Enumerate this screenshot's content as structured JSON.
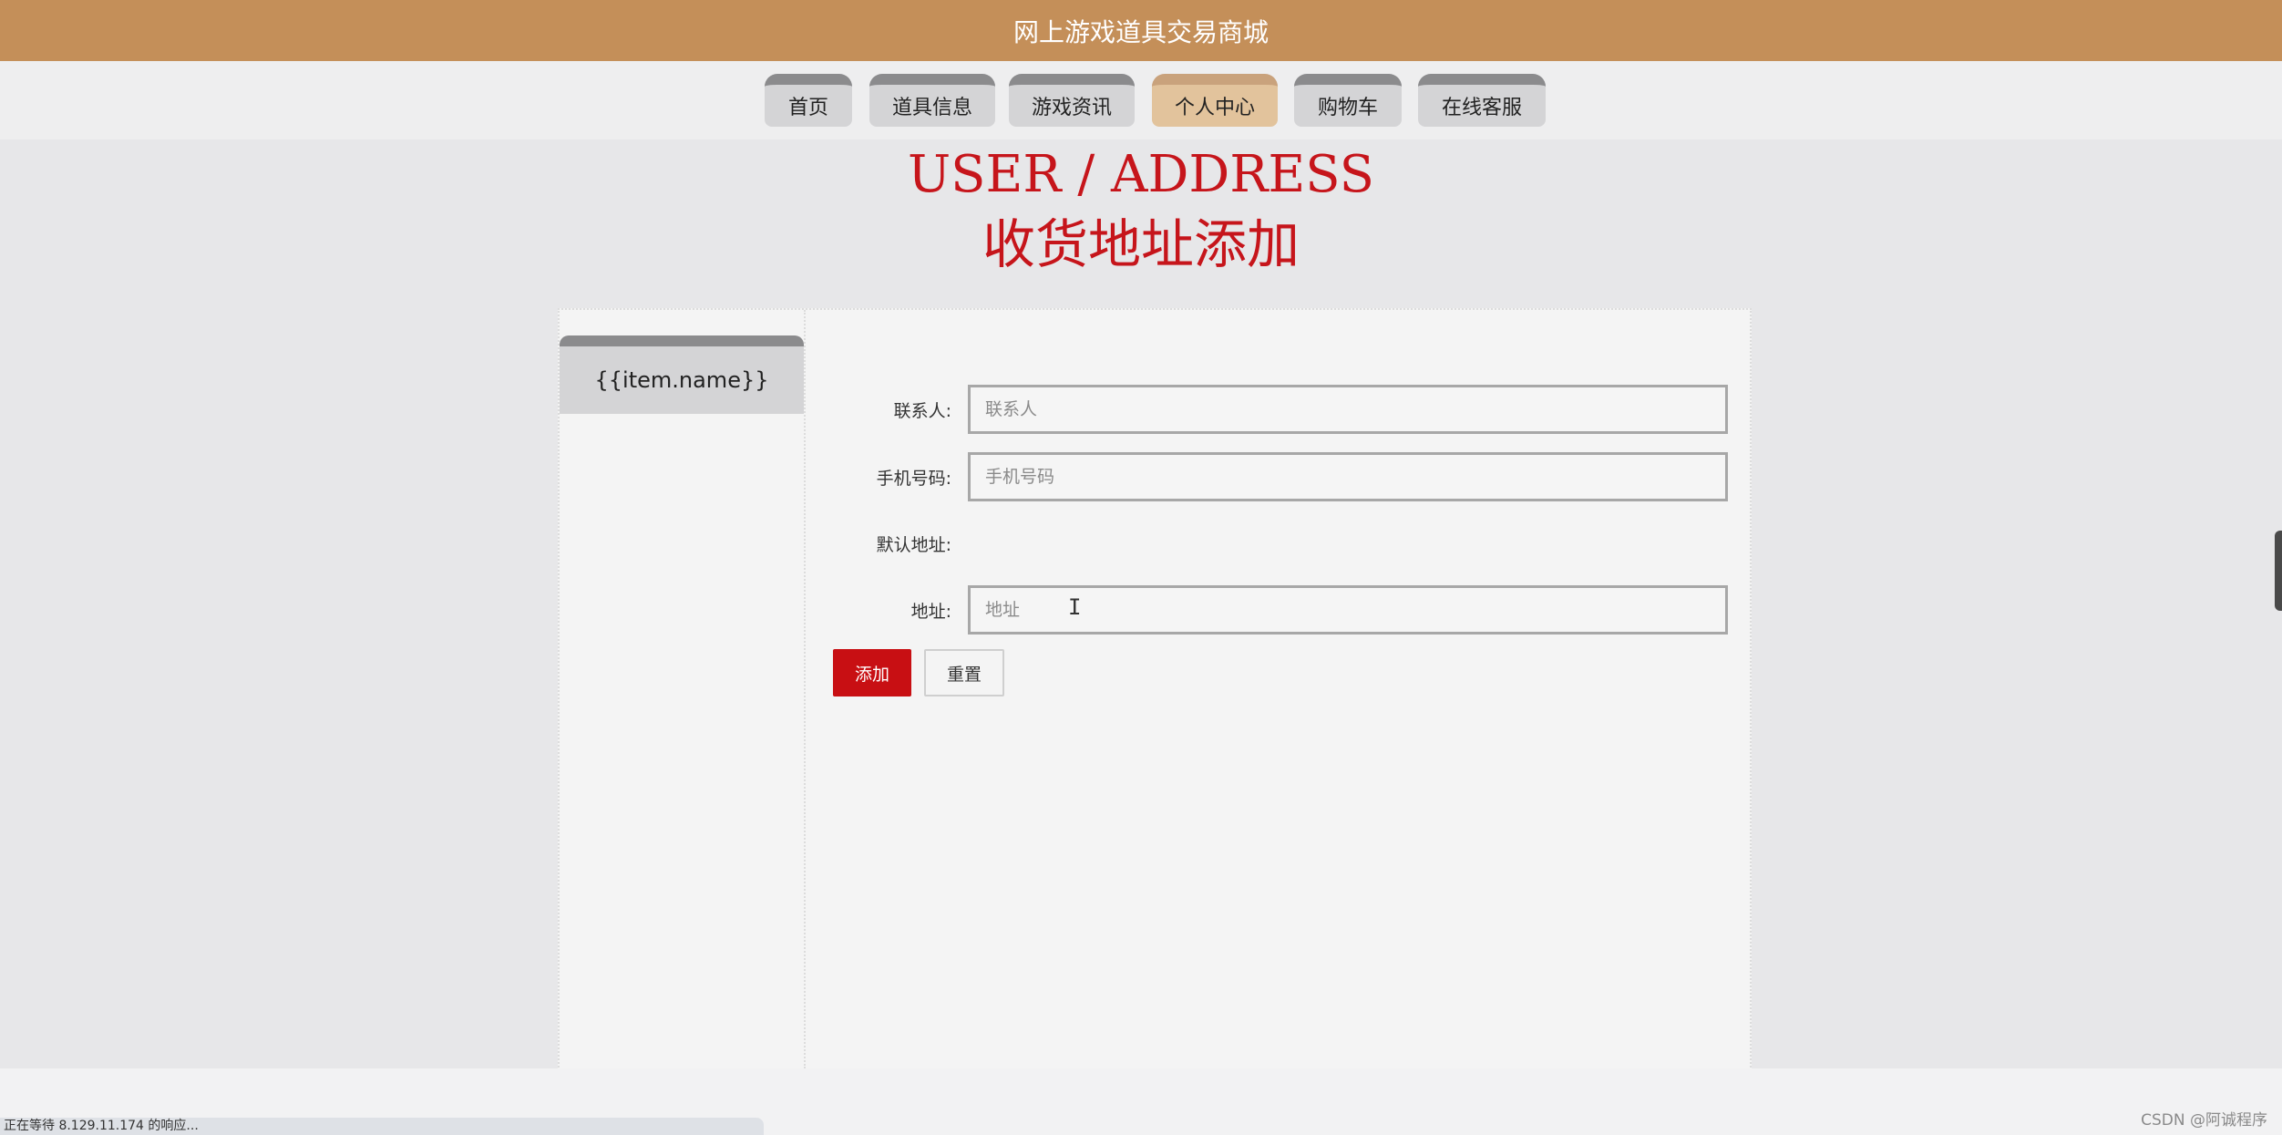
{
  "header": {
    "site_title": "网上游戏道具交易商城"
  },
  "nav": {
    "items": [
      {
        "label": "首页"
      },
      {
        "label": "道具信息"
      },
      {
        "label": "游戏资讯"
      },
      {
        "label": "个人中心"
      },
      {
        "label": "购物车"
      },
      {
        "label": "在线客服"
      }
    ],
    "active": "个人中心"
  },
  "page": {
    "title_en": "USER / ADDRESS",
    "title_cn": "收货地址添加"
  },
  "sidebar": {
    "items": [
      {
        "label": "{{item.name}}"
      }
    ]
  },
  "form": {
    "contact": {
      "label": "联系人:",
      "placeholder": "联系人",
      "value": ""
    },
    "phone": {
      "label": "手机号码:",
      "placeholder": "手机号码",
      "value": ""
    },
    "is_default": {
      "label": "默认地址:"
    },
    "address": {
      "label": "地址:",
      "placeholder": "地址",
      "value": ""
    },
    "submit_label": "添加",
    "reset_label": "重置"
  },
  "status_bar": {
    "text": "正在等待 8.129.11.174 的响应..."
  },
  "watermark": {
    "text": "CSDN @阿诚程序"
  },
  "colors": {
    "header_bg": "#c48f59",
    "accent_red": "#c6151b",
    "button_red": "#c80f13",
    "active_tab": "#e2c39c"
  }
}
